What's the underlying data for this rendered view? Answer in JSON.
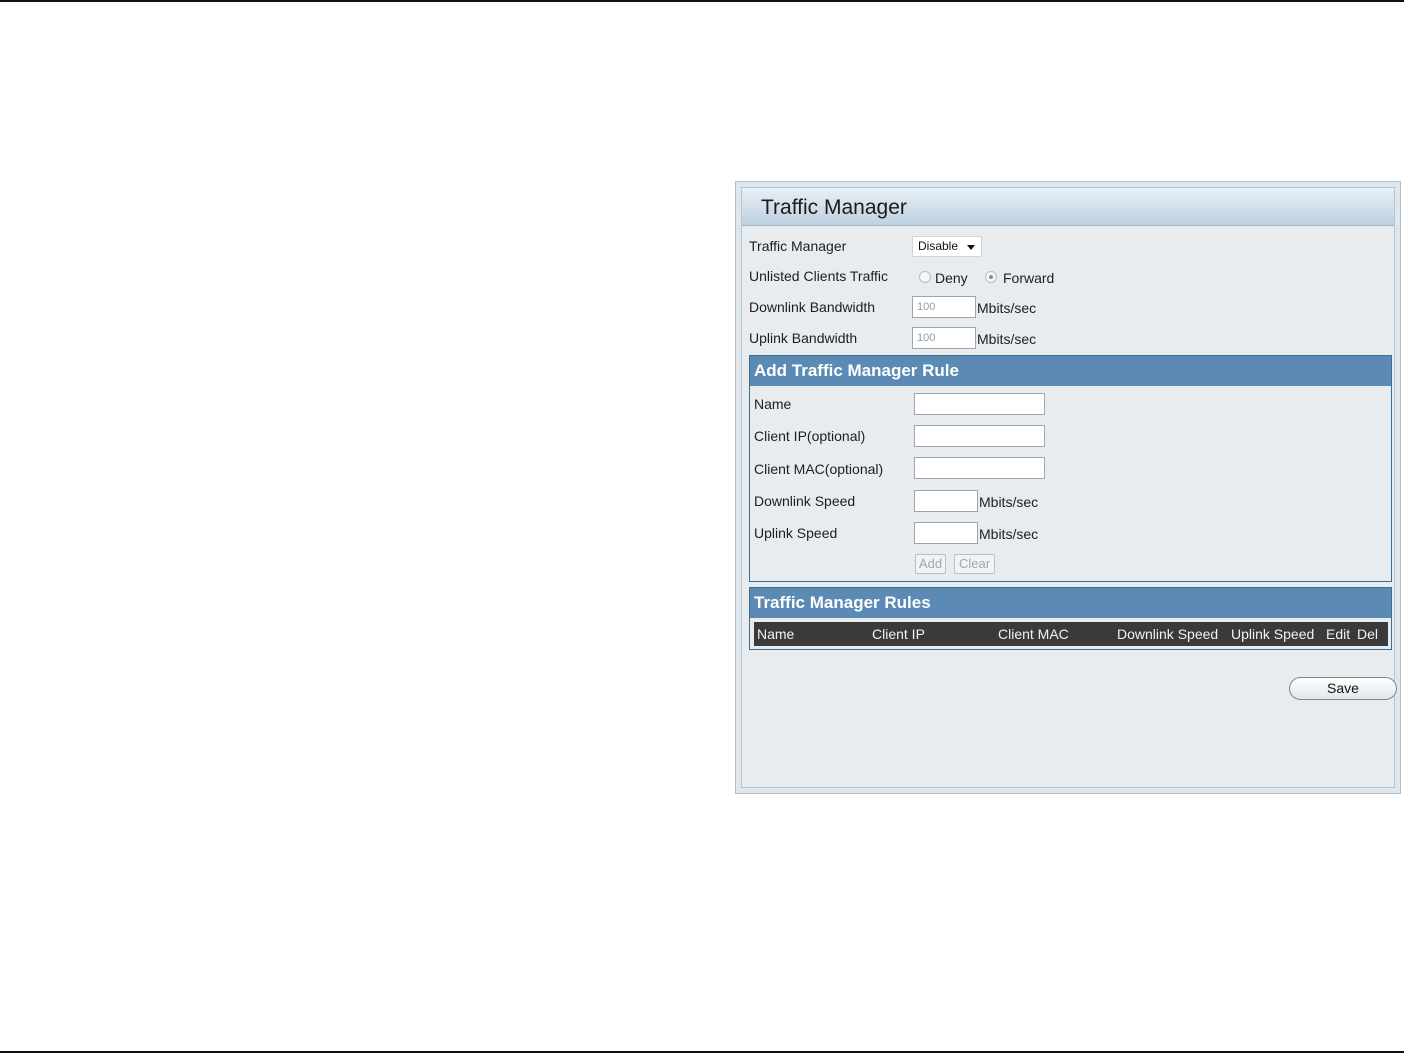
{
  "panel": {
    "title": "Traffic Manager"
  },
  "settings": {
    "traffic_manager_label": "Traffic Manager",
    "traffic_manager_value": "Disable",
    "unlisted_clients_label": "Unlisted Clients Traffic",
    "deny_label": "Deny",
    "forward_label": "Forward",
    "unlisted_clients_selected": "Forward",
    "downlink_bandwidth_label": "Downlink Bandwidth",
    "downlink_bandwidth_value": "100",
    "uplink_bandwidth_label": "Uplink Bandwidth",
    "uplink_bandwidth_value": "100",
    "unit": "Mbits/sec"
  },
  "add_rule": {
    "title": "Add Traffic Manager Rule",
    "name_label": "Name",
    "client_ip_label": "Client IP(optional)",
    "client_mac_label": "Client MAC(optional)",
    "downlink_speed_label": "Downlink Speed",
    "uplink_speed_label": "Uplink Speed",
    "unit": "Mbits/sec",
    "add_button": "Add",
    "clear_button": "Clear"
  },
  "rules": {
    "title": "Traffic Manager Rules",
    "columns": [
      "Name",
      "Client IP",
      "Client MAC",
      "Downlink Speed",
      "Uplink Speed",
      "Edit",
      "Del"
    ]
  },
  "save_button": "Save",
  "colors": {
    "section_header": "#5b8bb5",
    "table_header": "#3a3a3a",
    "panel_background": "#e8ecef"
  }
}
